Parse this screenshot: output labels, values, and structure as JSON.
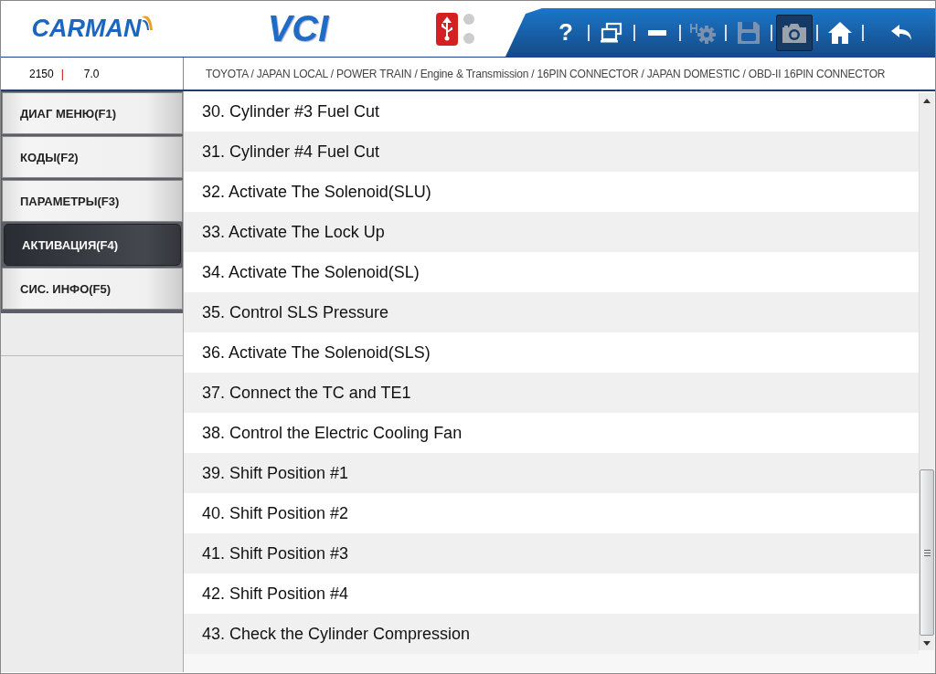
{
  "header": {
    "logo": "CARMAN",
    "product": "VCI"
  },
  "toolbar": [
    {
      "kind": "help",
      "label": "?",
      "disabled": false,
      "selected": false
    },
    {
      "kind": "windows",
      "disabled": false,
      "selected": false
    },
    {
      "kind": "minimize",
      "disabled": false,
      "selected": false
    },
    {
      "kind": "settings",
      "disabled": true,
      "selected": false
    },
    {
      "kind": "save",
      "disabled": true,
      "selected": false
    },
    {
      "kind": "camera",
      "disabled": false,
      "selected": true
    },
    {
      "kind": "home",
      "disabled": false,
      "selected": false
    },
    {
      "kind": "back",
      "disabled": false,
      "selected": false
    }
  ],
  "info": {
    "code": "2150",
    "separator": "|",
    "version": "7.0",
    "breadcrumb": "TOYOTA / JAPAN LOCAL / POWER TRAIN / Engine & Transmission / 16PIN CONNECTOR / JAPAN DOMESTIC / OBD-II 16PIN CONNECTOR"
  },
  "sidebar": {
    "items": [
      {
        "label": "ДИАГ МЕНЮ(F1)",
        "selected": false
      },
      {
        "label": "КОДЫ(F2)",
        "selected": false
      },
      {
        "label": "ПАРАМЕТРЫ(F3)",
        "selected": false
      },
      {
        "label": "АКТИВАЦИЯ(F4)",
        "selected": true
      },
      {
        "label": "СИС. ИНФО(F5)",
        "selected": false
      }
    ]
  },
  "list": {
    "items": [
      "30. Cylinder #3 Fuel Cut",
      "31. Cylinder #4 Fuel Cut",
      "32. Activate The Solenoid(SLU)",
      "33. Activate The Lock Up",
      "34. Activate The Solenoid(SL)",
      "35. Control SLS Pressure",
      "36. Activate The Solenoid(SLS)",
      "37. Connect the TC and TE1",
      "38. Control the Electric Cooling Fan",
      "39. Shift Position #1",
      "40. Shift Position #2",
      "41. Shift Position #3",
      "42. Shift Position #4",
      "43. Check the Cylinder Compression"
    ]
  }
}
